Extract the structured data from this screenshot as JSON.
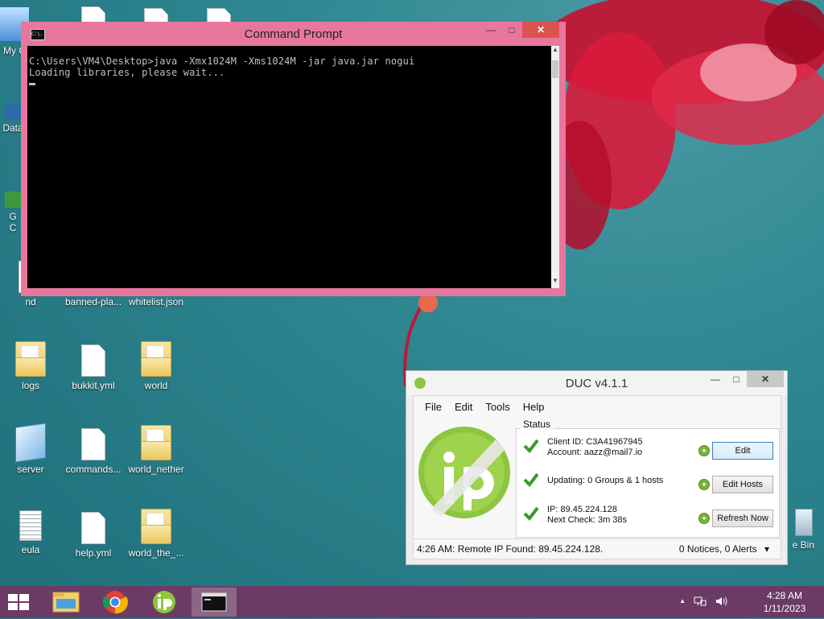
{
  "desktop": {
    "icons": [
      {
        "label": "My C"
      },
      {
        "label": ""
      },
      {
        "label": ""
      },
      {
        "label": ""
      },
      {
        "label": "Data"
      },
      {
        "label": "G\nC"
      },
      {
        "label": "nd"
      },
      {
        "label": "banned-pla..."
      },
      {
        "label": "whitelist.json"
      },
      {
        "label": "logs"
      },
      {
        "label": "bukkit.yml"
      },
      {
        "label": "world"
      },
      {
        "label": "server"
      },
      {
        "label": "commands..."
      },
      {
        "label": "world_nether"
      },
      {
        "label": "eula"
      },
      {
        "label": "help.yml"
      },
      {
        "label": "world_the_..."
      },
      {
        "label": "e Bin"
      }
    ]
  },
  "cmd": {
    "title": "Command Prompt",
    "icon_text": "C:\\.",
    "lines": [
      "C:\\Users\\VM4\\Desktop>java -Xmx1024M -Xms1024M -jar java.jar nogui",
      "Loading libraries, please wait..."
    ]
  },
  "duc": {
    "title": "DUC v4.1.1",
    "menu": [
      "File",
      "Edit",
      "Tools",
      "Help"
    ],
    "status_label": "Status",
    "rows": [
      {
        "line1": "Client ID: C3A41967945",
        "line2": "Account: aazz@mail7.io",
        "button": "Edit"
      },
      {
        "line1": "Updating: 0 Groups & 1 hosts",
        "line2": "",
        "button": "Edit Hosts"
      },
      {
        "line1": "IP: 89.45.224.128",
        "line2": "Next Check: 3m 38s",
        "button": "Refresh Now"
      }
    ],
    "statusbar_left": "4:26 AM: Remote IP Found: 89.45.224.128.",
    "statusbar_right": "0 Notices, 0 Alerts",
    "dropdown_glyph": "▾"
  },
  "taskbar": {
    "items": [
      "file-explorer-icon",
      "chrome-icon",
      "duc-icon",
      "command-prompt-icon"
    ],
    "tray_chevron": "▲",
    "clock": {
      "time": "4:28 AM",
      "date": "1/11/2023"
    }
  },
  "colors": {
    "cmd_frame": "#e8779e",
    "taskbar": "#6b3b66",
    "duc_green": "#8cc63f"
  }
}
